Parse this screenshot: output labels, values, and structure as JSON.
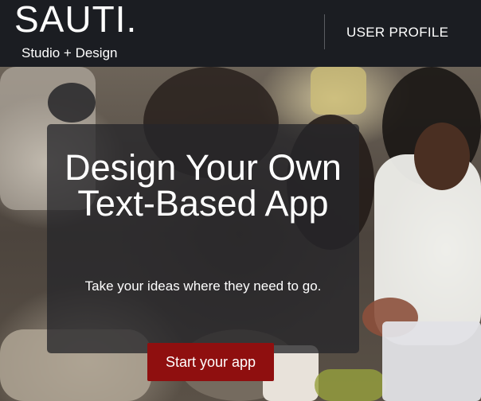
{
  "header": {
    "logo": "SAUTI.",
    "tagline": "Studio + Design",
    "nav_profile": "USER PROFILE"
  },
  "hero": {
    "headline": "Design Your Own Text-Based App",
    "subhead": "Take your ideas where they need to go.",
    "cta_label": "Start your app"
  },
  "colors": {
    "header_bg": "#1b1d22",
    "cta_bg": "#8f0f0f",
    "card_bg": "#26262a"
  }
}
